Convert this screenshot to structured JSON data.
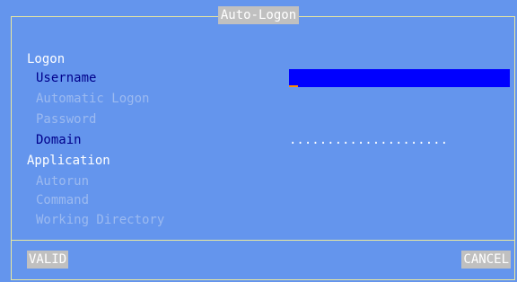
{
  "dialog": {
    "title": "Auto-Logon"
  },
  "sections": {
    "logon": "Logon",
    "application": "Application"
  },
  "fields": {
    "username": "Username",
    "automatic_logon": "Automatic Logon",
    "password": "Password",
    "domain": "Domain",
    "autorun": "Autorun",
    "command": "Command",
    "working_directory": "Working Directory"
  },
  "values": {
    "username": "",
    "domain": "....................."
  },
  "buttons": {
    "valid": "VALID",
    "cancel": "CANCEL"
  },
  "colors": {
    "background": "#6495ed",
    "title_bg": "#c0c0c0",
    "active_label": "#00008b",
    "dim_label": "#9cbaf0",
    "input_bg": "#0000ff",
    "cursor": "#ff8c00"
  }
}
